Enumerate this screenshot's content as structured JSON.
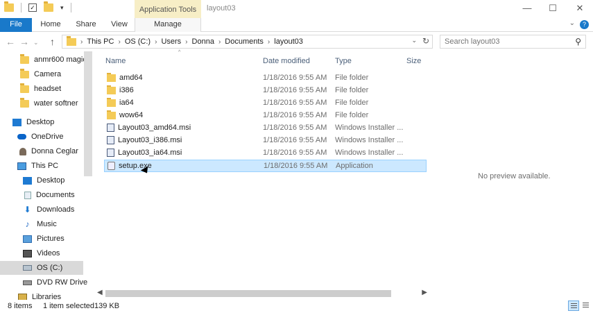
{
  "titlebar": {
    "contextual_tab": "Application Tools",
    "window_title": "layout03",
    "minimize": "—",
    "maximize": "☐",
    "close": "✕"
  },
  "ribbon": {
    "tabs": [
      "File",
      "Home",
      "Share",
      "View",
      "Manage"
    ],
    "help": "?"
  },
  "address": {
    "crumbs": [
      "This PC",
      "OS (C:)",
      "Users",
      "Donna",
      "Documents",
      "layout03"
    ],
    "search_placeholder": "Search layout03"
  },
  "nav": {
    "items": [
      {
        "label": "anmr600 magic",
        "icon": "folder-icon"
      },
      {
        "label": "Camera",
        "icon": "folder-icon"
      },
      {
        "label": "headset",
        "icon": "folder-icon"
      },
      {
        "label": "water softner",
        "icon": "folder-icon"
      },
      {
        "label": "Desktop",
        "icon": "desktop-icon"
      },
      {
        "label": "OneDrive",
        "icon": "onedrive-icon"
      },
      {
        "label": "Donna Ceglar",
        "icon": "user-icon"
      },
      {
        "label": "This PC",
        "icon": "pc-icon"
      },
      {
        "label": "Desktop",
        "icon": "desktop-icon"
      },
      {
        "label": "Documents",
        "icon": "documents-icon"
      },
      {
        "label": "Downloads",
        "icon": "downloads-icon"
      },
      {
        "label": "Music",
        "icon": "music-icon"
      },
      {
        "label": "Pictures",
        "icon": "pictures-icon"
      },
      {
        "label": "Videos",
        "icon": "videos-icon"
      },
      {
        "label": "OS (C:)",
        "icon": "drive-icon"
      },
      {
        "label": "DVD RW Drive",
        "icon": "dvd-icon"
      },
      {
        "label": "Libraries",
        "icon": "libraries-icon"
      }
    ]
  },
  "files": {
    "columns": {
      "name": "Name",
      "date": "Date modified",
      "type": "Type",
      "size": "Size"
    },
    "rows": [
      {
        "name": "amd64",
        "date": "1/18/2016 9:55 AM",
        "type": "File folder",
        "icon": "folder-icon"
      },
      {
        "name": "i386",
        "date": "1/18/2016 9:55 AM",
        "type": "File folder",
        "icon": "folder-icon"
      },
      {
        "name": "ia64",
        "date": "1/18/2016 9:55 AM",
        "type": "File folder",
        "icon": "folder-icon"
      },
      {
        "name": "wow64",
        "date": "1/18/2016 9:55 AM",
        "type": "File folder",
        "icon": "folder-icon"
      },
      {
        "name": "Layout03_amd64.msi",
        "date": "1/18/2016 9:55 AM",
        "type": "Windows Installer ...",
        "icon": "msi-icon"
      },
      {
        "name": "Layout03_i386.msi",
        "date": "1/18/2016 9:55 AM",
        "type": "Windows Installer ...",
        "icon": "msi-icon"
      },
      {
        "name": "Layout03_ia64.msi",
        "date": "1/18/2016 9:55 AM",
        "type": "Windows Installer ...",
        "icon": "msi-icon"
      },
      {
        "name": "setup.exe",
        "date": "1/18/2016 9:55 AM",
        "type": "Application",
        "icon": "exe-icon",
        "selected": true
      }
    ]
  },
  "preview": {
    "text": "No preview available."
  },
  "status": {
    "count": "8 items",
    "selection": "1 item selected",
    "size": "139 KB"
  },
  "colors": {
    "accent": "#1979ca",
    "selection": "#cce8ff",
    "contextual_tab": "#f7eec6"
  }
}
